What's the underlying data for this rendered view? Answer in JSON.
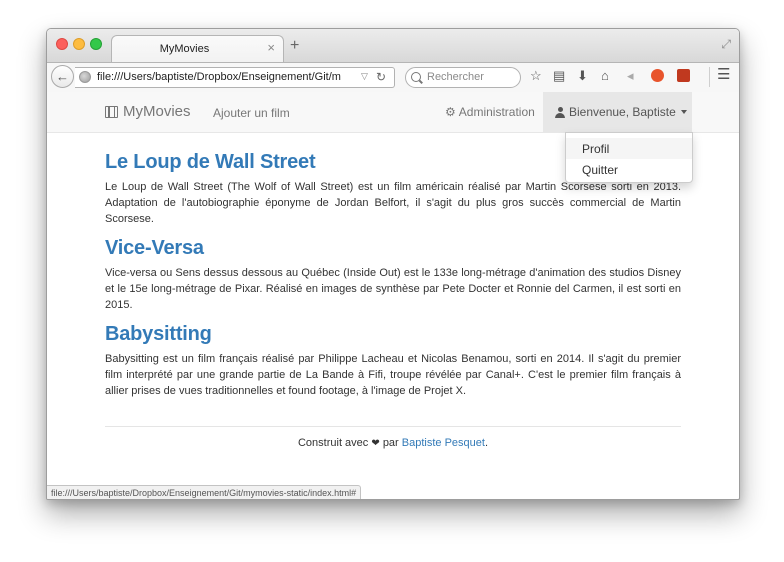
{
  "browser": {
    "tab_title": "MyMovies",
    "tab_close": "×",
    "new_tab": "+",
    "url": "file:///Users/baptiste/Dropbox/Enseignement/Git/m",
    "search_placeholder": "Rechercher",
    "status_url": "file:///Users/baptiste/Dropbox/Enseignement/Git/mymovies-static/index.html#"
  },
  "navbar": {
    "brand": "MyMovies",
    "add_film": "Ajouter un film",
    "admin": "Administration",
    "user": "Bienvenue, Baptiste",
    "dropdown": {
      "profile": "Profil",
      "logout": "Quitter"
    }
  },
  "films": [
    {
      "title": "Le Loup de Wall Street",
      "description": "Le Loup de Wall Street (The Wolf of Wall Street) est un film américain réalisé par Martin Scorsese sorti en 2013. Adaptation de l'autobiographie éponyme de Jordan Belfort, il s'agit du plus gros succès commercial de Martin Scorsese."
    },
    {
      "title": "Vice-Versa",
      "description": "Vice-versa ou Sens dessus dessous au Québec (Inside Out) est le 133e long-métrage d'animation des studios Disney et le 15e long-métrage de Pixar. Réalisé en images de synthèse par Pete Docter et Ronnie del Carmen, il est sorti en 2015."
    },
    {
      "title": "Babysitting",
      "description": "Babysitting est un film français réalisé par Philippe Lacheau et Nicolas Benamou, sorti en 2014. Il s'agit du premier film interprété par une grande partie de La Bande à Fifi, troupe révélée par Canal+. C'est le premier film français à allier prises de vues traditionnelles et found footage, à l'image de Projet X."
    }
  ],
  "footer": {
    "prefix": "Construit avec",
    "heart": "❤",
    "by": "par",
    "author": "Baptiste Pesquet",
    "suffix": "."
  },
  "colors": {
    "link": "#337ab7",
    "navbar_bg": "#f8f8f8",
    "active_nav_bg": "#e7e7e7"
  }
}
